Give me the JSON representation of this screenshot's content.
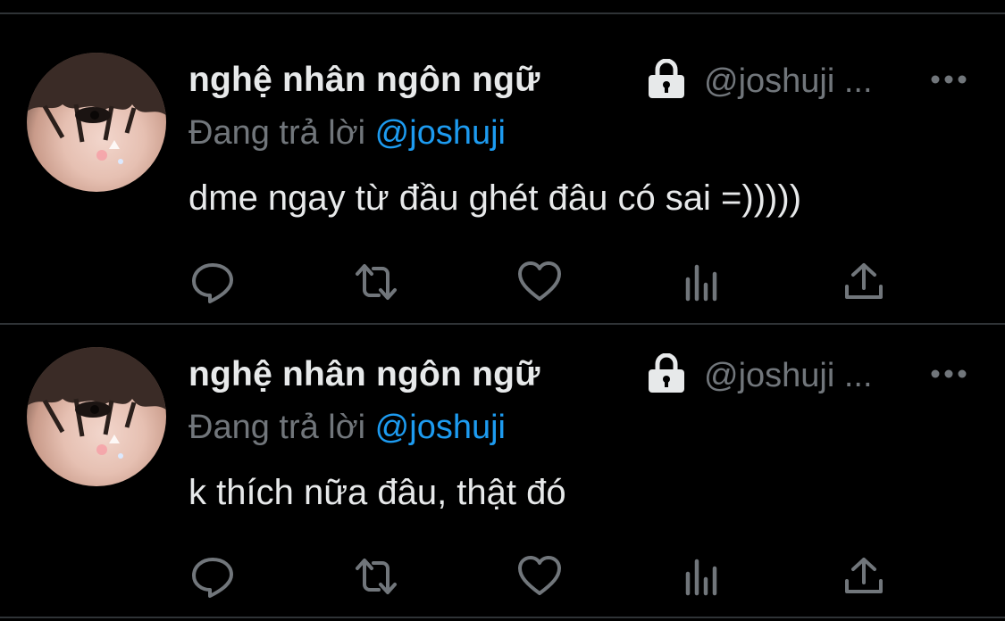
{
  "colors": {
    "background": "#000000",
    "divider": "#2f3336",
    "primary_text": "#e7e9ea",
    "secondary_text": "#71767b",
    "accent": "#1d9bf0"
  },
  "tweets": [
    {
      "author_name": "nghệ nhân ngôn ngữ",
      "handle": "@joshuji ...",
      "protected_icon": "lock-icon",
      "reply_prefix": "Đang trả lời",
      "reply_mention": "@joshuji",
      "text": "dme ngay từ đầu ghét đâu có sai =)))))",
      "actions": [
        "reply-icon",
        "retweet-icon",
        "like-icon",
        "views-icon",
        "share-icon"
      ]
    },
    {
      "author_name": "nghệ nhân ngôn ngữ",
      "handle": "@joshuji ...",
      "protected_icon": "lock-icon",
      "reply_prefix": "Đang trả lời",
      "reply_mention": "@joshuji",
      "text": "k thích nữa đâu, thật đó",
      "actions": [
        "reply-icon",
        "retweet-icon",
        "like-icon",
        "views-icon",
        "share-icon"
      ]
    }
  ]
}
